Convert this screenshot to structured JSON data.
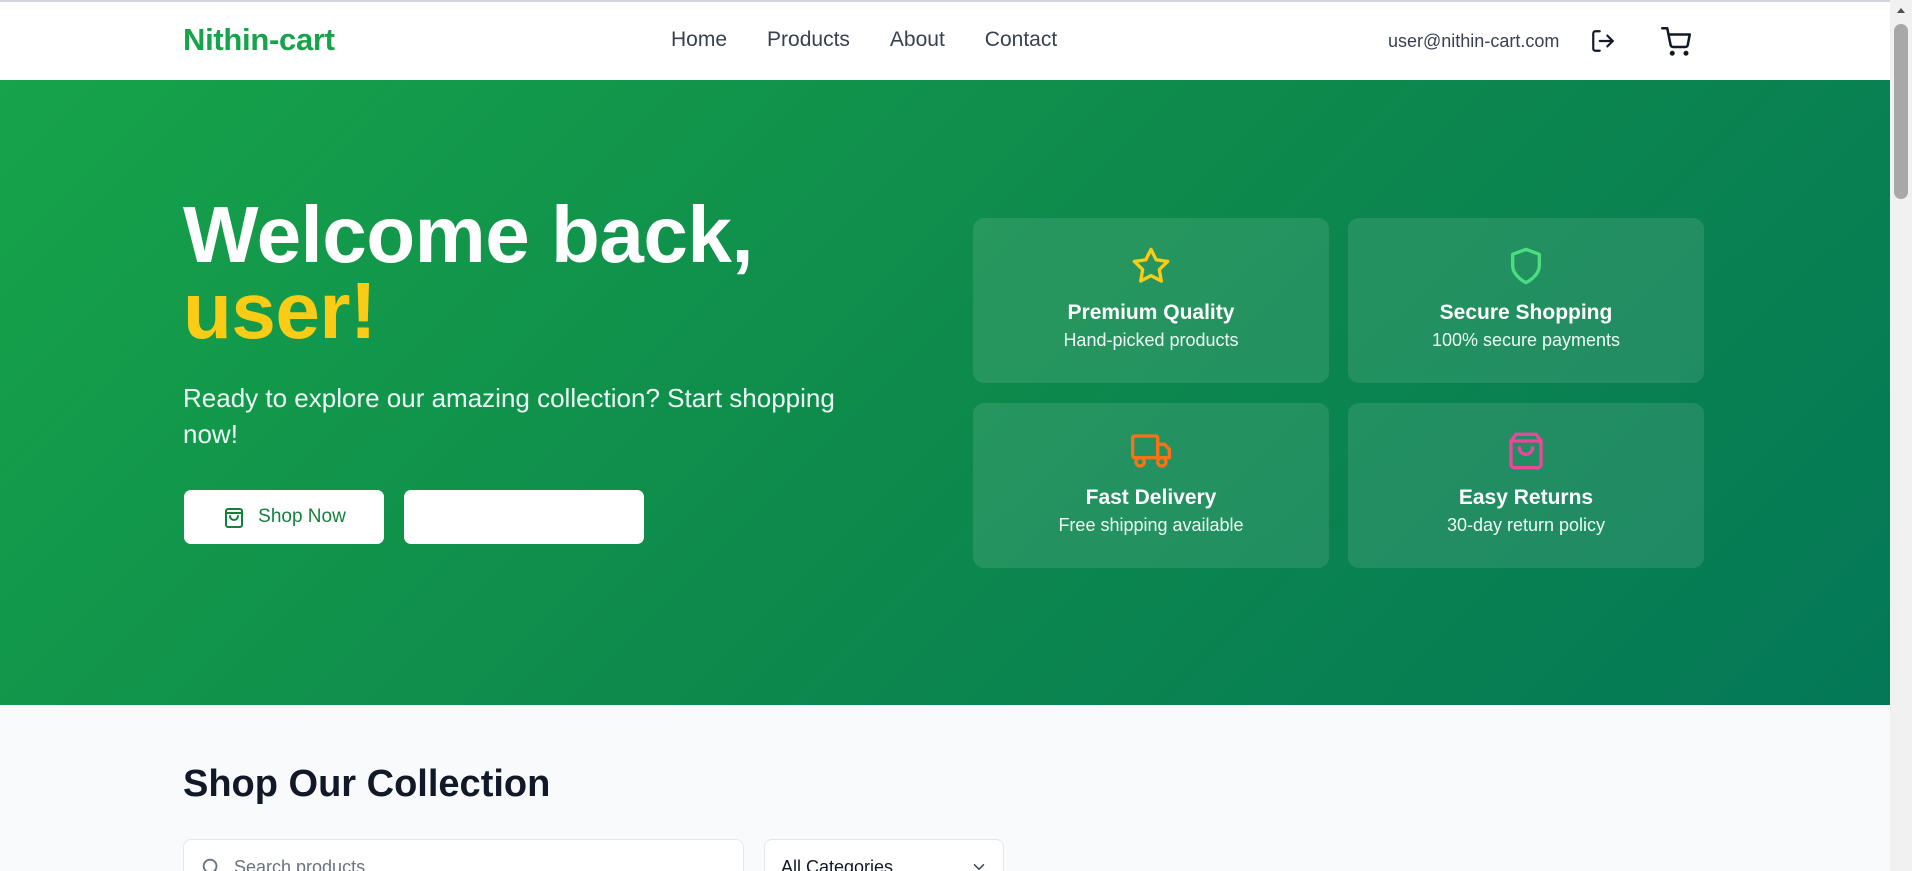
{
  "header": {
    "brand": "Nithin-cart",
    "nav": [
      "Home",
      "Products",
      "About",
      "Contact"
    ],
    "user_email": "user@nithin-cart.com",
    "logout_icon": "logout-icon",
    "cart_icon": "cart-icon"
  },
  "hero": {
    "title_line1": "Welcome back,",
    "title_name": "user!",
    "subtitle": "Ready to explore our amazing collection? Start shopping now!",
    "shop_button": "Shop Now",
    "secondary_button": "",
    "features": [
      {
        "title": "Premium Quality",
        "desc": "Hand-picked products",
        "icon": "star-icon",
        "color": "#facc15"
      },
      {
        "title": "Secure Shopping",
        "desc": "100% secure payments",
        "icon": "shield-icon",
        "color": "#4ade80"
      },
      {
        "title": "Fast Delivery",
        "desc": "Free shipping available",
        "icon": "truck-icon",
        "color": "#f97316"
      },
      {
        "title": "Easy Returns",
        "desc": "30-day return policy",
        "icon": "shopping-bag-icon",
        "color": "#ec4899"
      }
    ]
  },
  "collection": {
    "title": "Shop Our Collection",
    "search_placeholder": "Search products...",
    "category_value": "All Categories"
  },
  "colors": {
    "brand_green": "#16a34a",
    "hero_gradient_start": "#16a34a",
    "hero_gradient_end": "#047857",
    "name_highlight": "#facc15"
  }
}
